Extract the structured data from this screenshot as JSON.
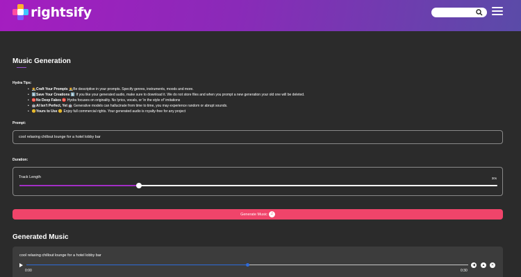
{
  "header": {
    "logo_text": "rightsify",
    "search": {
      "placeholder": "",
      "value": ""
    },
    "icons": {
      "search": "search-icon",
      "menu": "hamburger-menu-icon"
    },
    "gradient": [
      "#a51dc0",
      "#5a4ba8"
    ]
  },
  "main": {
    "title": "Music Generation",
    "tips_label": "Hydra Tips:",
    "tips": [
      {
        "emoji": "🧑‍🎨",
        "bold": "Craft Your Prompts",
        "emoji2": "🧑‍🎨",
        "text": "Be descriptive in your prompts. Specify genres, instruments, moods and more."
      },
      {
        "emoji": "⬇️",
        "bold": "Save Your Creations",
        "emoji2": "⬇️",
        "text": "If you like your generated audio, make sure to download it. We do not store files and when you prompt a new generation your old one will be deleted."
      },
      {
        "emoji": "⛔",
        "bold": "No Deep Fakes",
        "emoji2": "⛔",
        "text": "Hydra focuses on originality. No lyrics, vocals, or 'in the style of' imitations"
      },
      {
        "emoji": "🤖",
        "bold": "AI Isn't Perfect, Yet",
        "emoji2": "🤖",
        "text": "Generative models can hallucinate from time to time, you may experience random or abrupt sounds."
      },
      {
        "emoji": "😊",
        "bold": "Yours to Use",
        "emoji2": "😊",
        "text": "Enjoy full commercial rights. Your generated audio is royalty-free for any project"
      }
    ],
    "prompt_label": "Prompt:",
    "prompt_value": "cool relaxing chillout lounge for a hotel lobby bar",
    "duration_label": "Duration:",
    "track_length_label": "Track Length",
    "track_length_value": "30s",
    "track_length_fraction": 0.25,
    "generate_button": "Generate Music",
    "accent_color": "#f0446a",
    "slider_color": "#a32fc6"
  },
  "generated": {
    "title": "Generated Music",
    "track_title": "cool relaxing chillout lounge for a hotel lobby bar",
    "time_current": "0:00",
    "time_total": "0:30",
    "progress_fraction": 0.5,
    "progress_color": "#2f6bd9"
  }
}
